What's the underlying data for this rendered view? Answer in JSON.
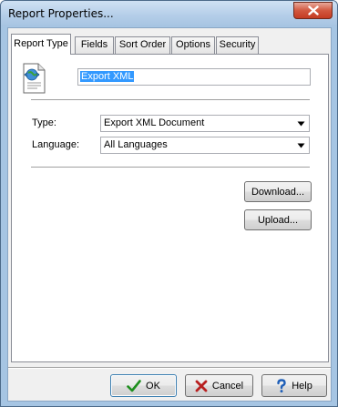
{
  "window": {
    "title": "Report Properties..."
  },
  "tabs": [
    {
      "label": "Report Type",
      "active": true
    },
    {
      "label": "Fields",
      "active": false
    },
    {
      "label": "Sort Order",
      "active": false
    },
    {
      "label": "Options",
      "active": false
    },
    {
      "label": "Security",
      "active": false
    }
  ],
  "report": {
    "icon": "xml-document-icon",
    "name_value": "Export XML",
    "type_label": "Type:",
    "type_value": "Export XML Document",
    "language_label": "Language:",
    "language_value": "All Languages"
  },
  "actions": {
    "download_label": "Download...",
    "upload_label": "Upload..."
  },
  "footer": {
    "ok_label": "OK",
    "cancel_label": "Cancel",
    "help_label": "Help"
  },
  "colors": {
    "ok_check": "#1e8f1e",
    "cancel_x": "#b81f1f",
    "help_mark": "#1f5fb8",
    "selection": "#3399ff"
  }
}
